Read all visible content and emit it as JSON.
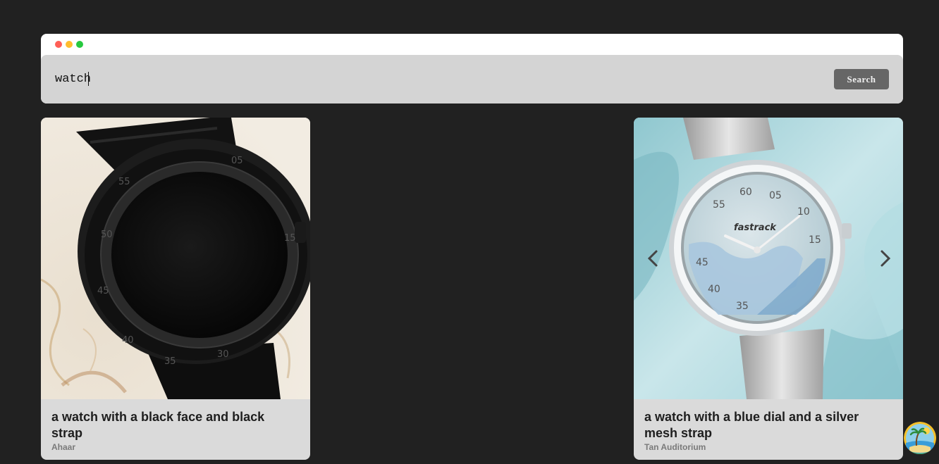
{
  "search": {
    "value": "watch",
    "button_label": "Search"
  },
  "results": [
    {
      "title": "a watch with a black face and black strap",
      "location": "Ahaar"
    },
    {
      "title": "a watch with a blue dial and a silver mesh strap",
      "location": "Tan Auditorium",
      "brand_text": "fastrack"
    }
  ],
  "colors": {
    "background": "#212121",
    "search_button": "#666666",
    "card": "#dadada"
  }
}
